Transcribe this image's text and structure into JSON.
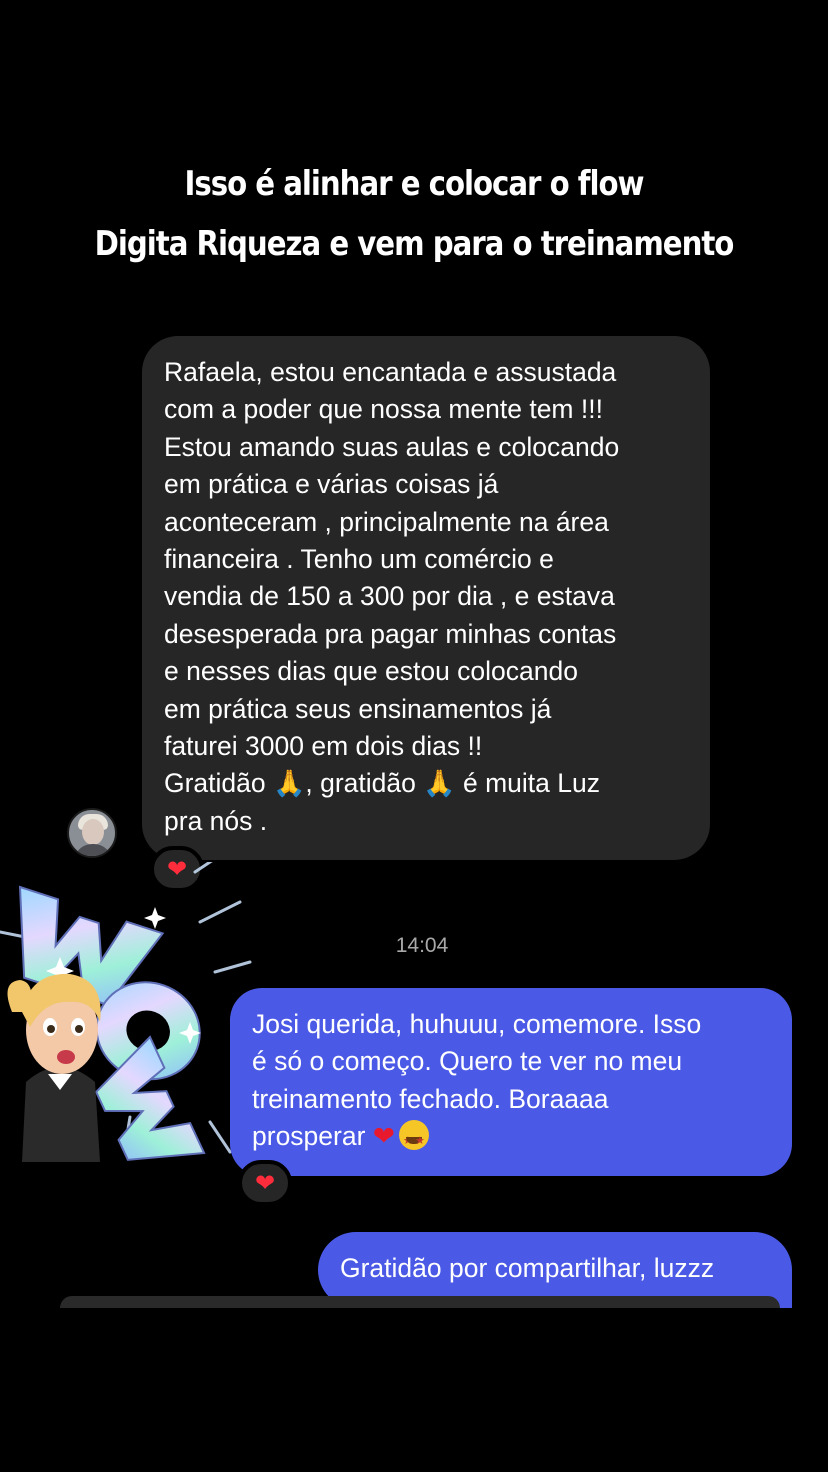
{
  "story_caption": {
    "line1": "Isso é alinhar e colocar o flow",
    "line2": "Digita Riqueza e vem para o treinamento"
  },
  "messages": [
    {
      "direction": "incoming",
      "text": "Rafaela, estou encantada e assustada\ncom a poder que nossa mente tem !!!\nEstou amando suas aulas e colocando\nem prática e várias coisas já\naconteceram , principalmente na área\nfinanceira . Tenho um comércio e\nvendia de 150 a 300 por dia , e estava\ndesesperada pra pagar minhas contas\ne nesses dias que estou colocando\nem prática seus ensinamentos já\nfaturei 3000 em dois dias !!",
      "text_tail_1": "Gratidão ",
      "text_tail_2": ", gratidão ",
      "text_tail_3": " é muita Luz",
      "text_tail_4": "pra nós .",
      "reaction": "❤"
    },
    {
      "direction": "outgoing",
      "text": "Josi querida, huhuuu, comemore. Isso\né só o começo. Quero te ver no meu\ntreinamento fechado. Boraaaa\nprosperar ",
      "reaction": "❤"
    },
    {
      "direction": "outgoing",
      "text": "Gratidão por compartilhar, luzzz"
    }
  ],
  "timestamp": "14:04",
  "sticker": "wow-memoji-sticker",
  "icons": {
    "pray": "🙏",
    "heart": "❤",
    "starstruck": "star-struck-emoji-icon"
  },
  "colors": {
    "background": "#000000",
    "incoming_bubble": "#262626",
    "outgoing_bubble": "#4b5ae6",
    "timestamp": "#a8a8a8"
  }
}
